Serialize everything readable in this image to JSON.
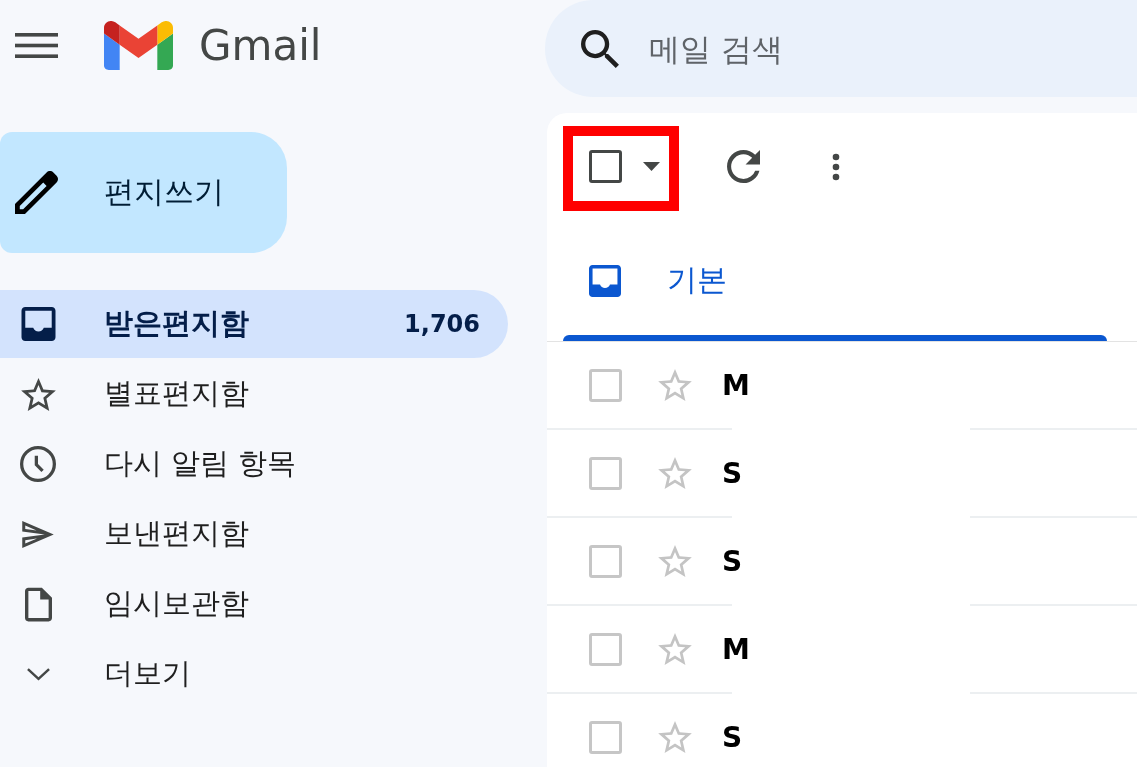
{
  "header": {
    "app_name": "Gmail",
    "search": {
      "placeholder": "메일 검색"
    }
  },
  "compose_button": {
    "label": "편지쓰기"
  },
  "sidebar": {
    "items": [
      {
        "kind": "inbox",
        "label": "받은편지함",
        "count": "1,706",
        "selected": true
      },
      {
        "kind": "starred",
        "label": "별표편지함",
        "selected": false
      },
      {
        "kind": "snoozed",
        "label": "다시 알림 항목",
        "selected": false
      },
      {
        "kind": "sent",
        "label": "보낸편지함",
        "selected": false
      },
      {
        "kind": "drafts",
        "label": "임시보관함",
        "selected": false
      },
      {
        "kind": "more",
        "label": "더보기",
        "selected": false
      }
    ]
  },
  "toolbar": {
    "select_all": {
      "checked": false,
      "highlighted": true
    }
  },
  "tabs": [
    {
      "label": "기본",
      "selected": true
    }
  ],
  "messages": [
    {
      "sender": "M",
      "checked": false,
      "starred": false,
      "unread": true
    },
    {
      "sender": "S",
      "checked": false,
      "starred": false,
      "unread": true
    },
    {
      "sender": "S",
      "checked": false,
      "starred": false,
      "unread": true
    },
    {
      "sender": "M",
      "checked": false,
      "starred": false,
      "unread": true
    },
    {
      "sender": "S",
      "checked": false,
      "starred": false,
      "unread": true
    }
  ]
}
